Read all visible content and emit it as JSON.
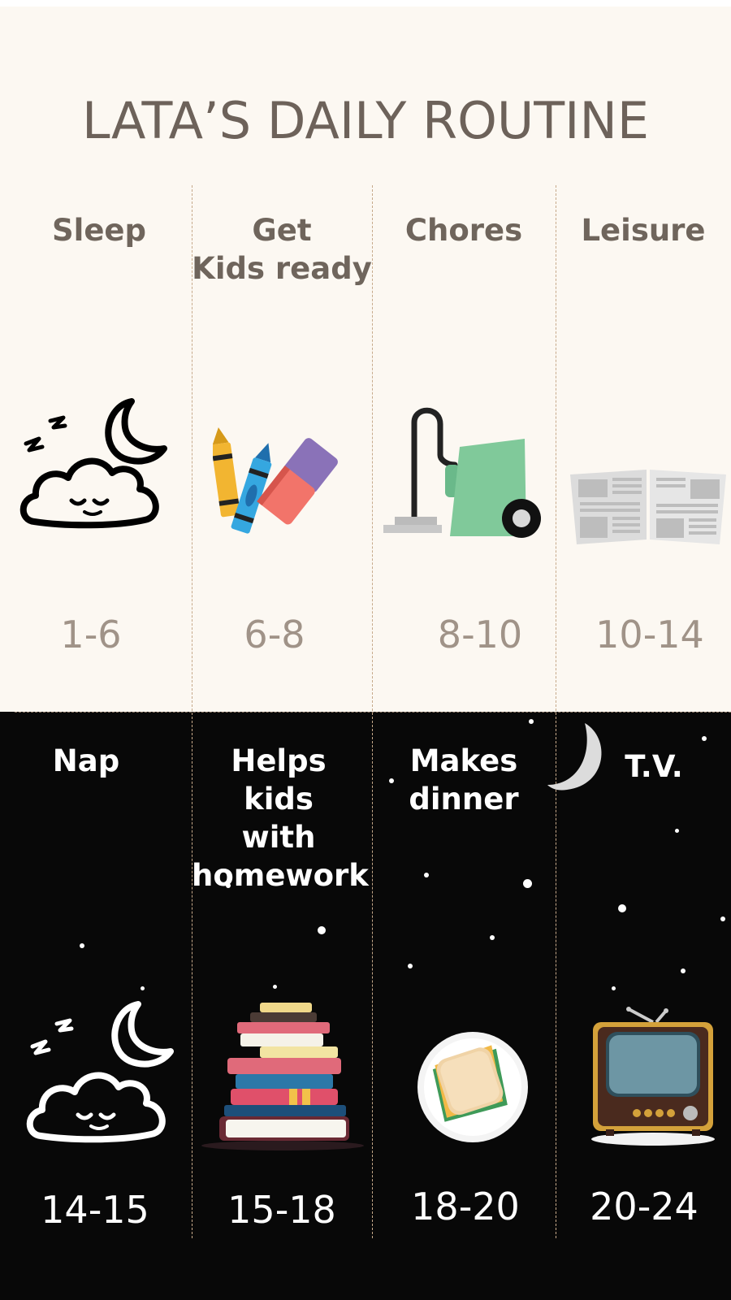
{
  "title": "LATA’S DAILY ROUTINE",
  "day_activities": [
    {
      "label": "Sleep",
      "time": "1-6",
      "icon": "sleeping-cloud-moon-icon"
    },
    {
      "label": "Get\nKids ready",
      "time": "6-8",
      "icon": "crayons-eraser-icon"
    },
    {
      "label": "Chores",
      "time": "8-10",
      "icon": "vacuum-cleaner-icon"
    },
    {
      "label": "Leisure",
      "time": "10-14",
      "icon": "newspaper-icon"
    }
  ],
  "night_activities": [
    {
      "label": "Nap",
      "time": "14-15",
      "icon": "sleeping-cloud-moon-icon"
    },
    {
      "label": "Helps kids\nwith\nhomework",
      "time": "15-18",
      "icon": "book-stack-icon"
    },
    {
      "label": "Makes\ndinner",
      "time": "18-20",
      "icon": "sandwich-plate-icon"
    },
    {
      "label": "T.V.",
      "time": "20-24",
      "icon": "retro-tv-icon"
    }
  ],
  "colors": {
    "day_background": "#fcf8f2",
    "night_background": "#080808",
    "title": "#6d625a",
    "day_label": "#6f655c",
    "day_time": "#a09388",
    "night_text": "#ffffff"
  }
}
